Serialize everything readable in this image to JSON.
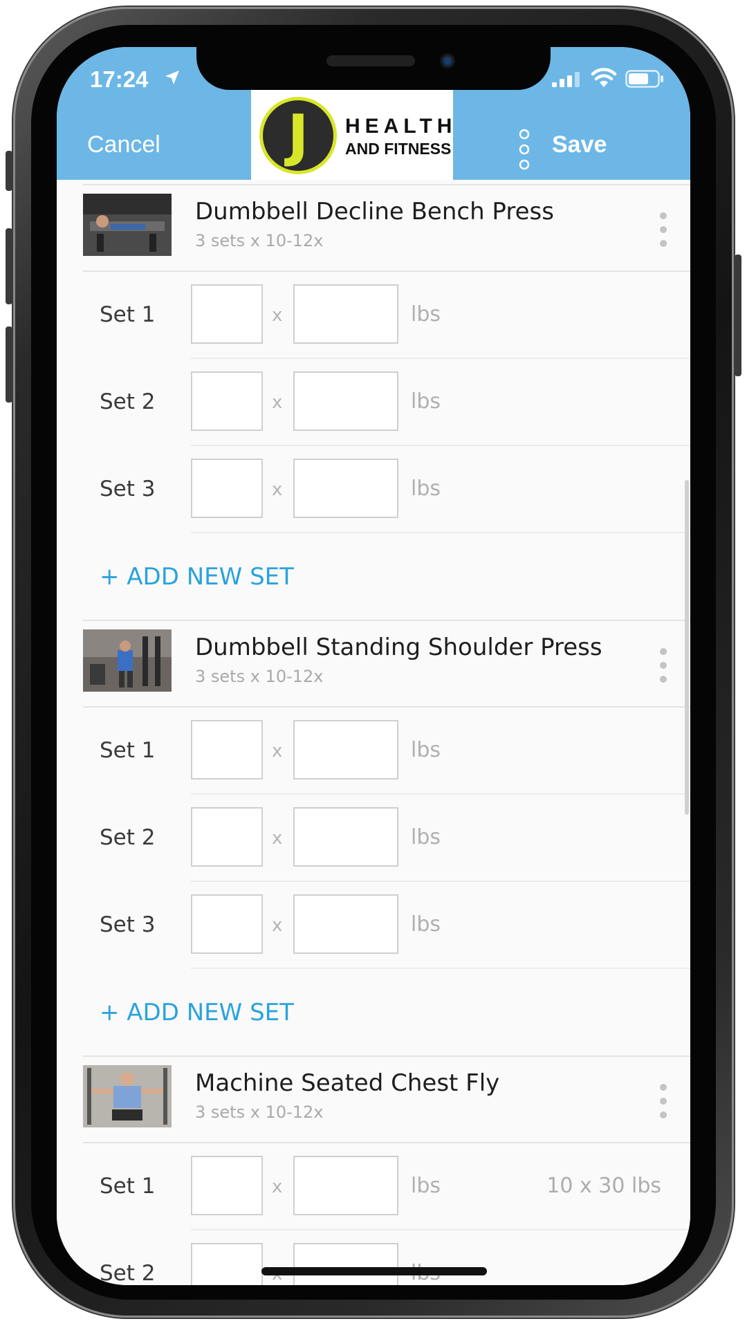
{
  "status_bar": {
    "time": "17:24"
  },
  "header": {
    "cancel_label": "Cancel",
    "save_label": "Save",
    "logo": {
      "letter": "J",
      "line1": "HEALTH",
      "line2": "AND FITNESS"
    }
  },
  "exercises": [
    {
      "name": "Dumbbell Decline Bench Press",
      "subtitle": "3 sets x 10-12x",
      "sets": [
        {
          "label": "Set 1",
          "times": "x",
          "unit": "lbs",
          "previous": ""
        },
        {
          "label": "Set 2",
          "times": "x",
          "unit": "lbs",
          "previous": ""
        },
        {
          "label": "Set 3",
          "times": "x",
          "unit": "lbs",
          "previous": ""
        }
      ],
      "add_set_label": "+ ADD NEW SET"
    },
    {
      "name": "Dumbbell Standing Shoulder Press",
      "subtitle": "3 sets x 10-12x",
      "sets": [
        {
          "label": "Set 1",
          "times": "x",
          "unit": "lbs",
          "previous": ""
        },
        {
          "label": "Set 2",
          "times": "x",
          "unit": "lbs",
          "previous": ""
        },
        {
          "label": "Set 3",
          "times": "x",
          "unit": "lbs",
          "previous": ""
        }
      ],
      "add_set_label": "+ ADD NEW SET"
    },
    {
      "name": "Machine Seated Chest Fly",
      "subtitle": "3 sets x 10-12x",
      "sets": [
        {
          "label": "Set 1",
          "times": "x",
          "unit": "lbs",
          "previous": "10 x 30 lbs"
        },
        {
          "label": "Set 2",
          "times": "x",
          "unit": "lbs",
          "previous": ""
        }
      ]
    }
  ],
  "colors": {
    "header_bg": "#6cb7e6",
    "accent": "#2aa3dc",
    "logo_yellow": "#d8e62a"
  },
  "icons": [
    "location-arrow-icon",
    "signal-icon",
    "wifi-icon",
    "battery-icon",
    "more-vertical-icon"
  ]
}
